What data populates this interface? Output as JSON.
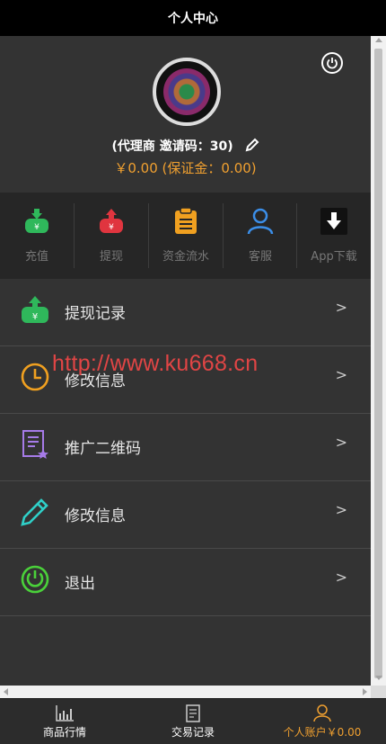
{
  "header": {
    "title": "个人中心"
  },
  "profile": {
    "role_line": "(代理商 邀请码：30)",
    "balance_line": "￥0.00 (保证金：0.00)"
  },
  "quick_actions": [
    {
      "label": "充值",
      "icon": "deposit-icon",
      "color": "#2fb85b"
    },
    {
      "label": "提现",
      "icon": "withdraw-icon",
      "color": "#e0353f"
    },
    {
      "label": "资金流水",
      "icon": "clipboard-icon",
      "color": "#f0a020"
    },
    {
      "label": "客服",
      "icon": "person-icon",
      "color": "#3b8ee8"
    },
    {
      "label": "App下载",
      "icon": "download-icon",
      "color": "#111111"
    }
  ],
  "menu": [
    {
      "label": "提现记录",
      "icon": "withdraw-record-icon",
      "arrow": ">"
    },
    {
      "label": "修改信息",
      "icon": "clock-icon",
      "arrow": ">"
    },
    {
      "label": "推广二维码",
      "icon": "document-star-icon",
      "arrow": ">"
    },
    {
      "label": "修改信息",
      "icon": "pencil-icon",
      "arrow": ">"
    },
    {
      "label": "退出",
      "icon": "power-icon",
      "arrow": ">"
    }
  ],
  "watermark": "http://www.ku668.cn",
  "bottom_nav": [
    {
      "label": "商品行情",
      "icon": "chart-icon"
    },
    {
      "label": "交易记录",
      "icon": "receipt-icon"
    },
    {
      "label": "个人账户￥0.00",
      "icon": "user-icon"
    }
  ],
  "colors": {
    "accent": "#f0a030",
    "background": "#333333"
  }
}
